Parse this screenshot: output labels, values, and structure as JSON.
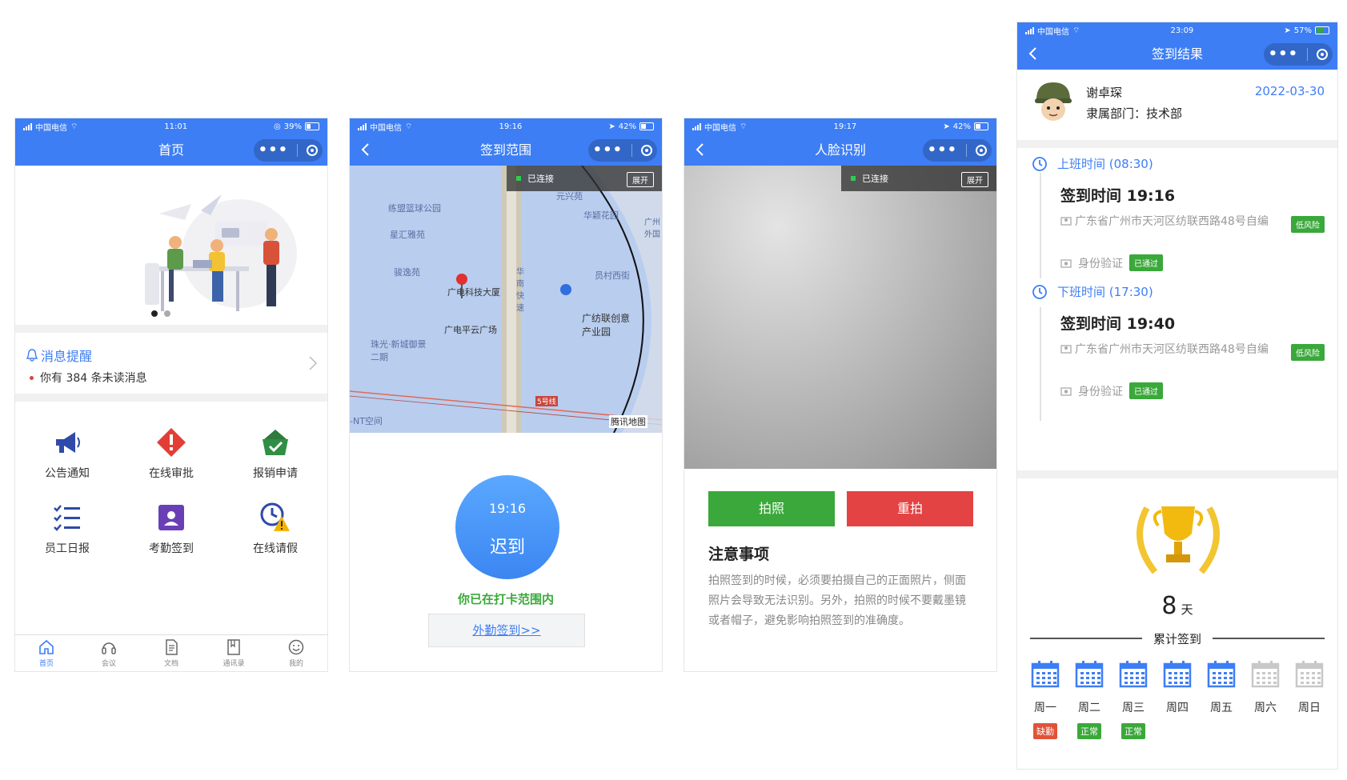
{
  "status_bars": [
    {
      "carrier": "中国电信",
      "time": "11:01",
      "battery": "39%"
    },
    {
      "carrier": "中国电信",
      "time": "19:16",
      "battery": "42%"
    },
    {
      "carrier": "中国电信",
      "time": "19:17",
      "battery": "42%"
    },
    {
      "carrier": "中国电信",
      "time": "23:09",
      "battery": "57%"
    }
  ],
  "capsule": {
    "dots": "•••"
  },
  "home": {
    "title": "首页",
    "notice_title": "消息提醒",
    "notice_msg": "你有 384 条未读消息",
    "grid": [
      {
        "label": "公告通知",
        "icon": "megaphone-icon"
      },
      {
        "label": "在线审批",
        "icon": "alert-diamond-icon"
      },
      {
        "label": "报销申请",
        "icon": "basket-check-icon"
      },
      {
        "label": "员工日报",
        "icon": "checklist-icon"
      },
      {
        "label": "考勤签到",
        "icon": "badge-user-icon"
      },
      {
        "label": "在线请假",
        "icon": "clock-warning-icon"
      }
    ],
    "tabs": [
      {
        "label": "首页",
        "icon": "home-icon"
      },
      {
        "label": "会议",
        "icon": "headset-icon"
      },
      {
        "label": "文档",
        "icon": "document-icon"
      },
      {
        "label": "通讯录",
        "icon": "bookmark-icon"
      },
      {
        "label": "我的",
        "icon": "smile-icon"
      }
    ]
  },
  "range": {
    "title": "签到范围",
    "connected": "已连接",
    "expand": "展开",
    "map_labels": [
      "练盟篮球公园",
      "星汇雅苑",
      "骏逸苑",
      "广电科技大厦",
      "广电平云广场",
      "珠光·新城御景二期",
      "员村西街",
      "广纺联创意产业园",
      "华颖花园",
      "广州外国",
      "华南快速",
      "-NT空间",
      "腾讯地图",
      "5号线",
      "元兴苑"
    ],
    "time": "19:16",
    "state": "迟到",
    "in_range": "你已在打卡范围内",
    "out_button": "外勤签到>>"
  },
  "face": {
    "title": "人脸识别",
    "connected": "已连接",
    "expand": "展开",
    "photo": "拍照",
    "retake": "重拍",
    "notes_title": "注意事项",
    "notes_body": "拍照签到的时候，必须要拍摄自己的正面照片，侧面照片会导致无法识别。另外，拍照的时候不要戴墨镜或者帽子，避免影响拍照签到的准确度。"
  },
  "result": {
    "title": "签到结果",
    "name": "谢卓琛",
    "dept": "隶属部门：技术部",
    "date": "2022-03-30",
    "on_head": "上班时间 (08:30)",
    "on_time": "签到时间 19:16",
    "on_loc": "广东省广州市天河区纺联西路48号自编",
    "on_risk": "低风险",
    "on_verify": "身份验证",
    "on_passed": "已通过",
    "off_head": "下班时间 (17:30)",
    "off_time": "签到时间 19:40",
    "off_loc": "广东省广州市天河区纺联西路48号自编",
    "off_risk": "低风险",
    "off_verify": "身份验证",
    "off_passed": "已通过",
    "days_num": "8",
    "days_unit": "天",
    "cumulative": "累计签到",
    "week": [
      {
        "day": "周一",
        "status": "缺勤",
        "color": "#e0533a",
        "active": true
      },
      {
        "day": "周二",
        "status": "正常",
        "color": "#3aa83a",
        "active": true
      },
      {
        "day": "周三",
        "status": "正常",
        "color": "#3aa83a",
        "active": true
      },
      {
        "day": "周四",
        "status": "",
        "color": "",
        "active": true
      },
      {
        "day": "周五",
        "status": "",
        "color": "",
        "active": true
      },
      {
        "day": "周六",
        "status": "",
        "color": "",
        "active": false
      },
      {
        "day": "周日",
        "status": "",
        "color": "",
        "active": false
      }
    ]
  },
  "colors": {
    "primary": "#3d7ef5",
    "green": "#3aa83a",
    "red": "#e34343"
  }
}
